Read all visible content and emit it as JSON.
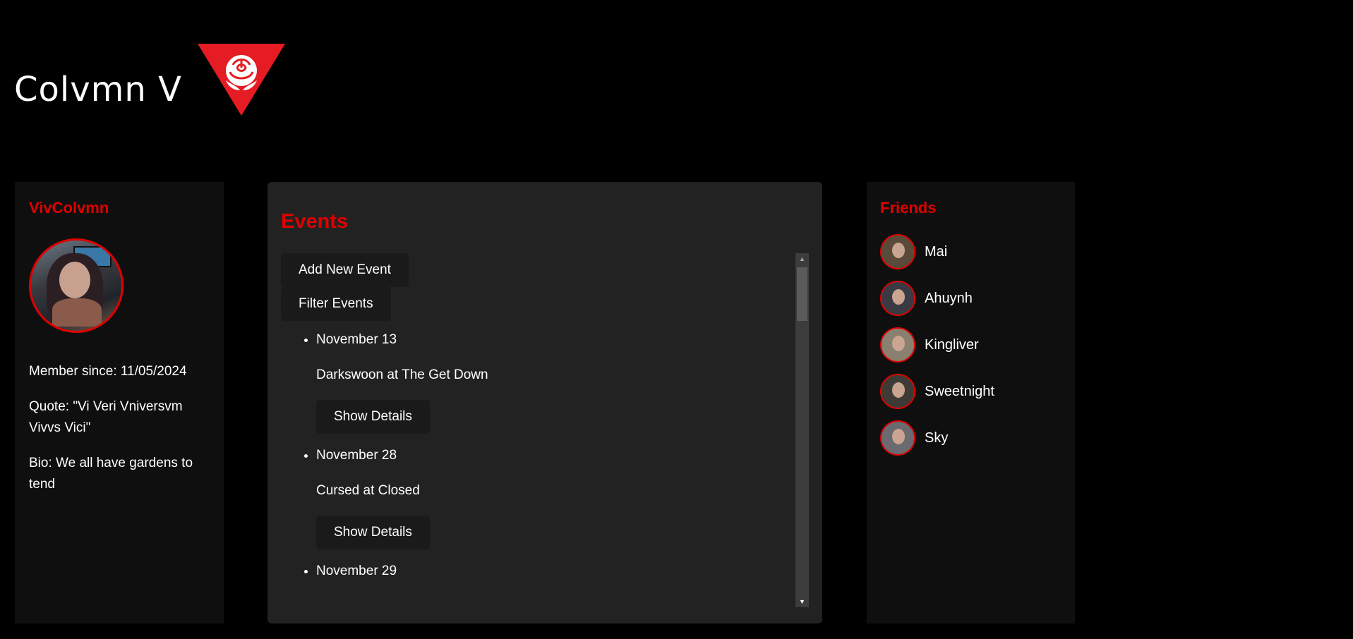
{
  "brand": {
    "name": "Colvmn V",
    "logo_icon": "rose-triangle-icon",
    "accent": "#e00000"
  },
  "profile": {
    "username": "VivColvmn",
    "member_since": "Member since: 11/05/2024",
    "quote": "Quote: \"Vi Veri Vniversvm Vivvs Vici\"",
    "bio": "Bio: We all have gardens to tend"
  },
  "events": {
    "title": "Events",
    "add_label": "Add New Event",
    "filter_label": "Filter Events",
    "items": [
      {
        "date": "November 13",
        "name": "Darkswoon at The Get Down",
        "button": "Show Details"
      },
      {
        "date": "November 28",
        "name": "Cursed at Closed",
        "button": "Show Details"
      },
      {
        "date": "November 29"
      }
    ]
  },
  "friends": {
    "title": "Friends",
    "items": [
      {
        "name": "Mai",
        "avatar_color": "#5a4a3a"
      },
      {
        "name": "Ahuynh",
        "avatar_color": "#3a3a44"
      },
      {
        "name": "Kingliver",
        "avatar_color": "#8a8070"
      },
      {
        "name": "Sweetnight",
        "avatar_color": "#3e3a36"
      },
      {
        "name": "Sky",
        "avatar_color": "#6a6a70"
      }
    ]
  }
}
